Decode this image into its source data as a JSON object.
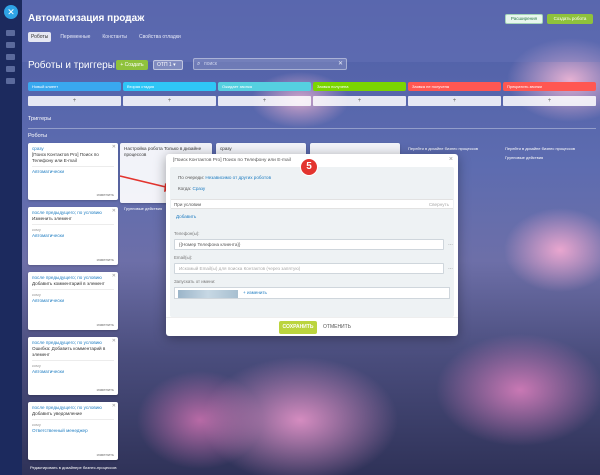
{
  "header": {
    "title": "Автоматизация продаж",
    "btn_extensions": "Расширения",
    "btn_create_robot": "Создать робота",
    "tabs": [
      "Роботы",
      "Переменные",
      "Константы",
      "Свойства отладки"
    ]
  },
  "toolbar": {
    "heading": "Роботы и триггеры",
    "add_label": "+ Создать",
    "select_value": "ОТП 1",
    "search_placeholder": "поиск"
  },
  "stages": [
    {
      "label": "Новый клиент",
      "color": "#39a8ef"
    },
    {
      "label": "Вторая стадия",
      "color": "#2fc6f6"
    },
    {
      "label": "Ожидает звонка",
      "color": "#55d0e0"
    },
    {
      "label": "Заявка получена",
      "color": "#7bd500"
    },
    {
      "label": "Заявка не получена",
      "color": "#ff5752"
    },
    {
      "label": "Прекратить звонки",
      "color": "#ff5752"
    }
  ],
  "sections": {
    "triggers": "Триггеры",
    "robots": "Роботы"
  },
  "cards": [
    {
      "cond": "сразу",
      "text": "[Поиск Контактов Pro] Поиск по Телефону или E-mail",
      "who": "",
      "auto": "Автоматически",
      "edit": "изменить"
    },
    {
      "cond": "после предыдущего; по условию",
      "text": "Изменить элемент",
      "who": "кому",
      "auto": "Автоматически",
      "edit": "изменить"
    },
    {
      "cond": "после предыдущего; по условию",
      "text": "Добавить комментарий в элемент",
      "who": "кому",
      "auto": "Автоматически",
      "edit": "изменить"
    },
    {
      "cond": "после предыдущего; по условию",
      "text": "Ошибка: Добавить комментарий в элемент",
      "who": "кому",
      "auto": "Автоматически",
      "edit": "изменить"
    },
    {
      "cond": "после предыдущего; по условию",
      "text": "Добавить уведомление",
      "who": "кому",
      "auto": "Ответственный менеджер",
      "edit": "изменить"
    }
  ],
  "col2": {
    "title": "Настройка робота Только в дизайне процессов",
    "note": "Групповые действия"
  },
  "col3": {
    "cond": "сразу"
  },
  "notes": {
    "right1": "Перейти в дизайне бизнес процессов",
    "right2": "Групповые действия",
    "footer": "Редактировать в дизайнере бизнес-процессов"
  },
  "modal": {
    "title": "[Поиск Контактов Pro] Поиск по Телефону или E-mail",
    "queue_label": "По очереди:",
    "queue_value": "Независимо от других роботов",
    "when_label": "Когда:",
    "when_value": "Сразу",
    "cond_label": "При условии",
    "cond_right": "Свернуть",
    "add": "Добавить",
    "phone_label": "Телефон(ы):",
    "phone_value": "{{Номер Телефона клиента}}",
    "email_label": "Email(ы):",
    "email_value": "Искомый Email(ы) для поиска Контактов (через запятую)",
    "run_as_label": "Запускать от имени:",
    "change": "изменить",
    "save": "СОХРАНИТЬ",
    "cancel": "ОТМЕНИТЬ"
  },
  "badge": "5"
}
